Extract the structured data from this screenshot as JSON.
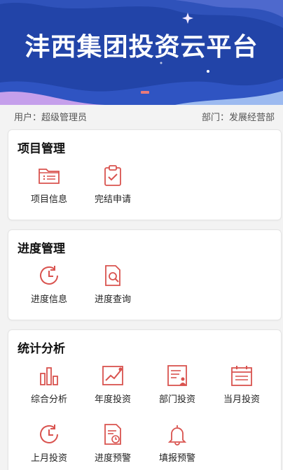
{
  "banner": {
    "title": "沣西集团投资云平台"
  },
  "user": {
    "user_label": "用户：超级管理员",
    "dept_label": "部门：发展经营部"
  },
  "sections": [
    {
      "title": "项目管理",
      "items": [
        {
          "label": "项目信息",
          "icon": "folder-list-icon"
        },
        {
          "label": "完结申请",
          "icon": "clipboard-check-icon"
        }
      ]
    },
    {
      "title": "进度管理",
      "items": [
        {
          "label": "进度信息",
          "icon": "clock-refresh-icon"
        },
        {
          "label": "进度查询",
          "icon": "document-search-icon"
        }
      ]
    },
    {
      "title": "统计分析",
      "items": [
        {
          "label": "综合分析",
          "icon": "bar-chart-icon"
        },
        {
          "label": "年度投资",
          "icon": "line-chart-icon"
        },
        {
          "label": "部门投资",
          "icon": "department-doc-icon"
        },
        {
          "label": "当月投资",
          "icon": "calendar-icon"
        },
        {
          "label": "上月投资",
          "icon": "clock-refresh-icon"
        },
        {
          "label": "进度预警",
          "icon": "document-alert-icon"
        },
        {
          "label": "填报预警",
          "icon": "bell-icon"
        }
      ]
    }
  ],
  "colors": {
    "banner_blue": "#2244a8",
    "icon_red": "#d9534f"
  }
}
